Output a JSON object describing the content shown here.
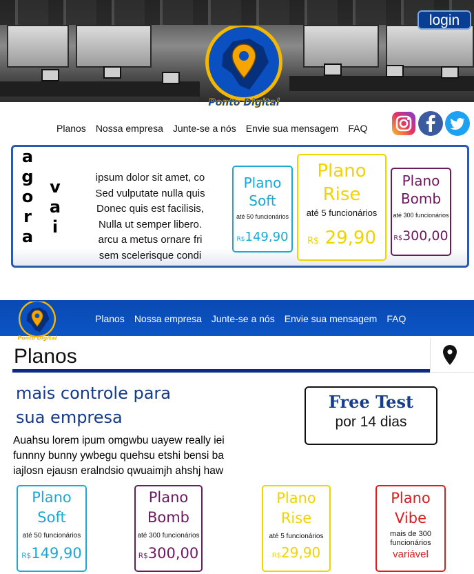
{
  "header": {
    "login_label": "login",
    "brand_name": "Ponto Digital"
  },
  "nav": {
    "items": [
      "Planos",
      "Nossa empresa",
      "Junte-se a nós",
      "Envie sua mensagem",
      "FAQ"
    ]
  },
  "social": [
    "instagram-icon",
    "facebook-icon",
    "twitter-icon"
  ],
  "banner": {
    "vertical_word_1": [
      "a",
      "g",
      "o",
      "r",
      "a"
    ],
    "vertical_word_2": [
      "v",
      "a",
      "i"
    ],
    "lorem_lines": [
      "ipsum dolor sit amet, co",
      "Sed vulputate nulla quis",
      "Donec quis est facilisis,",
      "Nulla ut semper libero.",
      "arcu a metus ornare fri",
      "sem scelerisque condi"
    ],
    "plans": [
      {
        "name_1": "Plano",
        "name_2": "Soft",
        "desc": "até 50 funcionários",
        "currency": "R$",
        "price": "149,90",
        "color": "#18a9d6"
      },
      {
        "name_1": "Plano",
        "name_2": "Rise",
        "desc": "até 5 funcionários",
        "currency": "R$",
        "price": "29,90",
        "color": "#f0d400"
      },
      {
        "name_1": "Plano",
        "name_2": "Bomb",
        "desc": "até 300 funcionários",
        "currency": "R$",
        "price": "300,00",
        "color": "#6b1a5f"
      }
    ]
  },
  "section": {
    "title": "Planos",
    "tagline_1": "mais controle para",
    "tagline_2": "sua empresa",
    "lorem_lines": [
      "Auahsu lorem ipum omgwbu uayew really iei",
      "funnny bunny ywbegu quehsu etshi bensi ba",
      "iajlosn ejausn eralndsio qwuaimjh ahshj haw"
    ],
    "free_test_title": "Free Test",
    "free_test_sub": "por 14 dias",
    "plans": [
      {
        "name_1": "Plano",
        "name_2": "Soft",
        "desc": "até 50 funcionários",
        "currency": "R$",
        "price": "149,90",
        "color": "#18a9d6"
      },
      {
        "name_1": "Plano",
        "name_2": "Bomb",
        "desc": "até 300 funcionários",
        "currency": "R$",
        "price": "300,00",
        "color": "#6b1a5f"
      },
      {
        "name_1": "Plano",
        "name_2": "Rise",
        "desc": "até 5 funcionários",
        "currency": "R$",
        "price": "29,90",
        "color": "#f0d400"
      },
      {
        "name_1": "Plano",
        "name_2": "Vibe",
        "desc_1": "mais de 300",
        "desc_2": "funcionários",
        "price": "variável",
        "color": "#e41a1a"
      }
    ]
  },
  "colors": {
    "brand_blue": "#0a49b2",
    "logo_yellow": "#f5b800",
    "dark_navy": "#0a2a86"
  }
}
